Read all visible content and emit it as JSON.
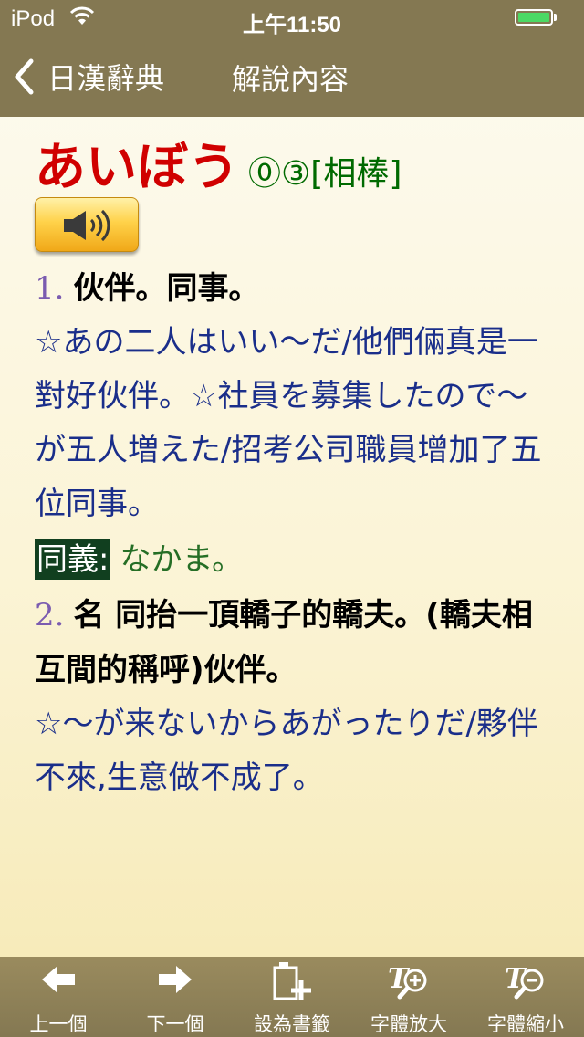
{
  "status_bar": {
    "carrier": "iPod",
    "time": "上午11:50",
    "battery_level": 1.0,
    "icons": [
      "wifi-icon",
      "battery-icon"
    ]
  },
  "nav": {
    "back_label": "日漢辭典",
    "title": "解說內容"
  },
  "entry": {
    "headword": "あいぼう",
    "accent": "⓪③",
    "kanji": "[相棒]",
    "speaker_icon": "speaker-icon",
    "senses": [
      {
        "number": "1.",
        "definition": "伙伴。同事。",
        "examples": "☆あの二人はいい～だ/他們倆真是一對好伙伴。☆社員を募集したので～が五人増えた/招考公司職員增加了五位同事。"
      },
      {
        "number": "2.",
        "definition": "名 同抬一頂轎子的轎夫。(轎夫相互間的稱呼)伙伴。",
        "examples": "☆～が来ないからあがったりだ/夥伴不來,生意做不成了。"
      }
    ],
    "synonym": {
      "label": "同義:",
      "word": "なかま。"
    }
  },
  "colors": {
    "bar": "#847852",
    "headword": "#d00000",
    "accent": "#006a00",
    "example": "#1a2e8a",
    "sense_number": "#7b5cb0",
    "synonym_label_bg": "#113f1f"
  },
  "toolbar": {
    "items": [
      {
        "label": "上一個",
        "icon": "arrow-left-icon"
      },
      {
        "label": "下一個",
        "icon": "arrow-right-icon"
      },
      {
        "label": "設為書籤",
        "icon": "add-bookmark-icon"
      },
      {
        "label": "字體放大",
        "icon": "font-zoom-in-icon"
      },
      {
        "label": "字體縮小",
        "icon": "font-zoom-out-icon"
      }
    ]
  }
}
